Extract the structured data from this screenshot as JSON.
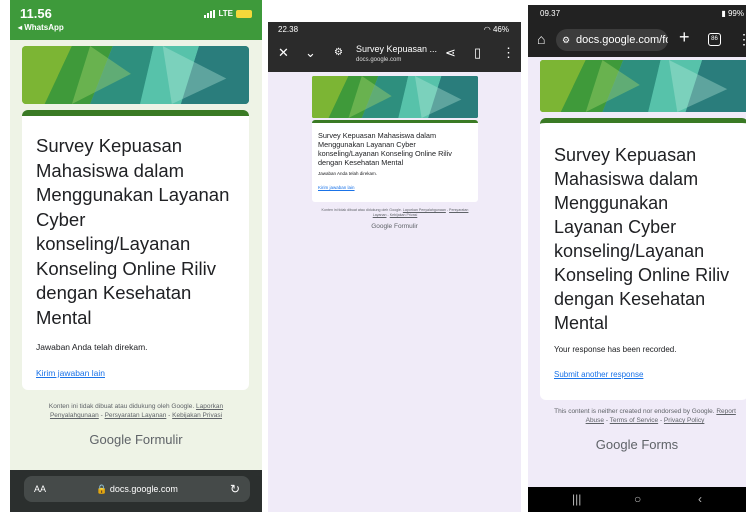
{
  "form": {
    "title_id": "Survey Kepuasan Mahasiswa dalam Menggunakan Layanan Cyber konseling/Layanan Konseling Online Riliv dengan Kesehatan Mental",
    "recorded_id": "Jawaban Anda telah direkam.",
    "submit_another_id": "Kirim jawaban lain",
    "disclaimer_id": "Konten ini tidak dibuat atau didukung oleh Google.",
    "report_abuse_id": "Laporkan Penyalahgunaan",
    "terms_id": "Persyaratan Layanan",
    "privacy_id": "Kebijakan Privasi",
    "recorded_en": "Your response has been recorded.",
    "submit_another_en": "Submit another response",
    "disclaimer_en": "This content is neither created nor endorsed by Google.",
    "report_abuse_en": "Report Abuse",
    "terms_en": "Terms of Service",
    "privacy_en": "Privacy Policy",
    "separator": " - ",
    "brand_google": "Google",
    "brand_formulir": "Formulir",
    "brand_forms": "Forms"
  },
  "panel1": {
    "time": "11.56",
    "back_label": "◂ WhatsApp",
    "network": "LTE",
    "aa_label": "AA",
    "url": "docs.google.com"
  },
  "panel2": {
    "time": "22.38",
    "battery": "46%",
    "toolbar_title": "Survey Kepuasan ...",
    "toolbar_subtitle": "docs.google.com"
  },
  "panel3": {
    "time": "09.37",
    "battery": "99%",
    "omnibox": "docs.google.com/for",
    "tabs_count": "86"
  },
  "colors": {
    "header_green": "#3e9a3b",
    "card_top": "#3a7a24",
    "link_blue": "#1a73e8",
    "form_bg": "#f0ebf8"
  }
}
